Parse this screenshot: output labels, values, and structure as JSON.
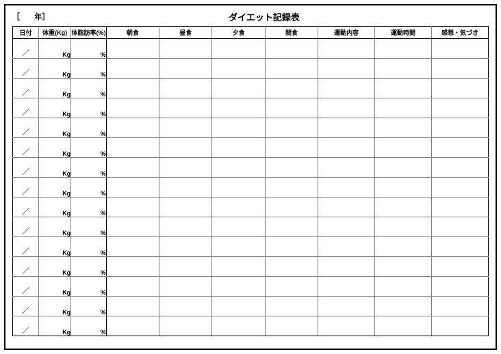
{
  "header": {
    "year_prefix": "［",
    "year_suffix": "年］",
    "title": "ダイエット記録表"
  },
  "columns": {
    "date": "日付",
    "weight": "体重(Kg)",
    "body_fat": "体脂肪率(%)",
    "breakfast": "朝食",
    "lunch": "昼食",
    "dinner": "夕食",
    "snack": "間食",
    "exercise_content": "運動内容",
    "exercise_time": "運動時間",
    "notes": "感想・気づき"
  },
  "row_template": {
    "date_sep": "／",
    "weight_unit": "Kg",
    "fat_unit": "%"
  },
  "rows": [
    {},
    {},
    {},
    {},
    {},
    {},
    {},
    {},
    {},
    {},
    {},
    {},
    {},
    {},
    {}
  ]
}
